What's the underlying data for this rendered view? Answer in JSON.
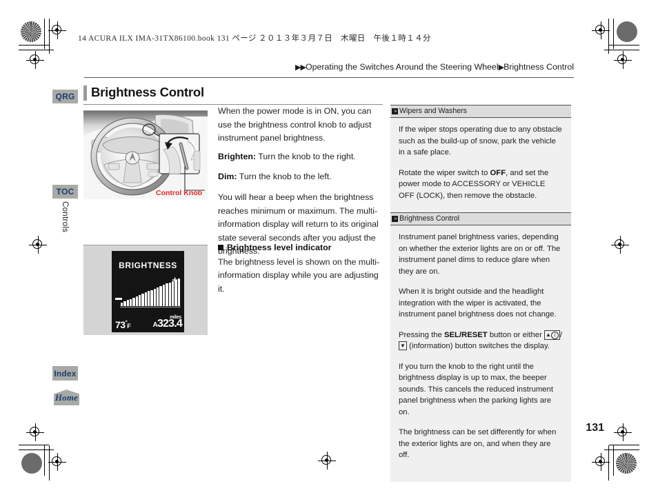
{
  "print": {
    "book_line": "14 ACURA  ILX  IMA-31TX86100.book   131 ページ   ２０１３年３月７日　木曜日　午後１時１４分"
  },
  "header": {
    "breadcrumb_arrow": "▶▶",
    "breadcrumb_part1": "Operating the Switches Around the Steering Wheel",
    "breadcrumb_sep": "▶",
    "breadcrumb_part2": "Brightness Control"
  },
  "sidebar": {
    "tabs": [
      {
        "id": "qrg",
        "label": "QRG"
      },
      {
        "id": "toc",
        "label": "TOC"
      },
      {
        "id": "index",
        "label": "Index"
      },
      {
        "id": "home",
        "label": "Home"
      }
    ],
    "chapter_tab": "Controls"
  },
  "page": {
    "title": "Brightness Control",
    "folio": "131"
  },
  "figures": {
    "wheel_caption": "Control Knob",
    "mid": {
      "title": "BRIGHTNESS",
      "plus": "+",
      "temperature": "73",
      "temp_degree": "°",
      "temp_unit": "F",
      "odometer_prefix": "A",
      "odometer": "323.4",
      "odometer_unit": "miles",
      "bar_count": 20
    }
  },
  "main": {
    "intro": "When the power mode is in ON, you can use the brightness control knob to adjust instrument panel brightness.",
    "brighten_label": "Brighten:",
    "brighten_text": " Turn the knob to the right.",
    "dim_label": "Dim:",
    "dim_text": " Turn the knob to the left.",
    "beep_para": "You will hear a beep when the brightness reaches minimum or maximum. The multi-information display will return to its original state several seconds after you adjust the brightness.",
    "subhead_title": "Brightness level indicator",
    "subhead_body": "The brightness level is shown on the multi-information display while you are adjusting it."
  },
  "reference": {
    "sections": [
      {
        "heading": "Wipers and Washers",
        "paragraphs": [
          {
            "parts": [
              {
                "t": "If the wiper stops operating due to any obstacle such as the build-up of snow, park the vehicle in a safe place.",
                "b": false
              }
            ]
          },
          {
            "parts": [
              {
                "t": "Rotate the wiper switch to ",
                "b": false
              },
              {
                "t": "OFF",
                "b": true
              },
              {
                "t": ", and set the power mode to ACCESSORY or VEHICLE OFF (LOCK), then remove the obstacle.",
                "b": false
              }
            ]
          }
        ]
      },
      {
        "heading": "Brightness Control",
        "paragraphs": [
          {
            "parts": [
              {
                "t": "Instrument panel brightness varies, depending on whether the exterior lights are on or off. The instrument panel dims to reduce glare when they are on.",
                "b": false
              }
            ]
          },
          {
            "parts": [
              {
                "t": "When it is bright outside and the headlight integration with the wiper is activated, the instrument panel brightness does not change.",
                "b": false
              }
            ]
          },
          {
            "keyline": true,
            "parts": [
              {
                "t": "Pressing the ",
                "b": false
              },
              {
                "t": "SEL/RESET",
                "b": true
              },
              {
                "t": " button or either ",
                "b": false
              }
            ],
            "tail": " (information) button switches the display.",
            "keycap_up": "▲",
            "keycap_sep": "/",
            "keycap_down": "▼",
            "keycap_info": "i"
          },
          {
            "parts": [
              {
                "t": "If you turn the knob to the right until the brightness display is up to max, the beeper sounds. This cancels the reduced instrument panel brightness when the parking lights are on.",
                "b": false
              }
            ]
          },
          {
            "parts": [
              {
                "t": "The brightness can be set differently for when the exterior lights are on, and when they are off.",
                "b": false
              }
            ]
          }
        ]
      }
    ]
  },
  "colors": {
    "accent_red": "#e8262a",
    "tab_bg": "#a8aaa6",
    "tab_text": "#1b3d6d",
    "panel_bg": "#f0f0f0",
    "panel_head_bg": "#dcdcdc"
  }
}
